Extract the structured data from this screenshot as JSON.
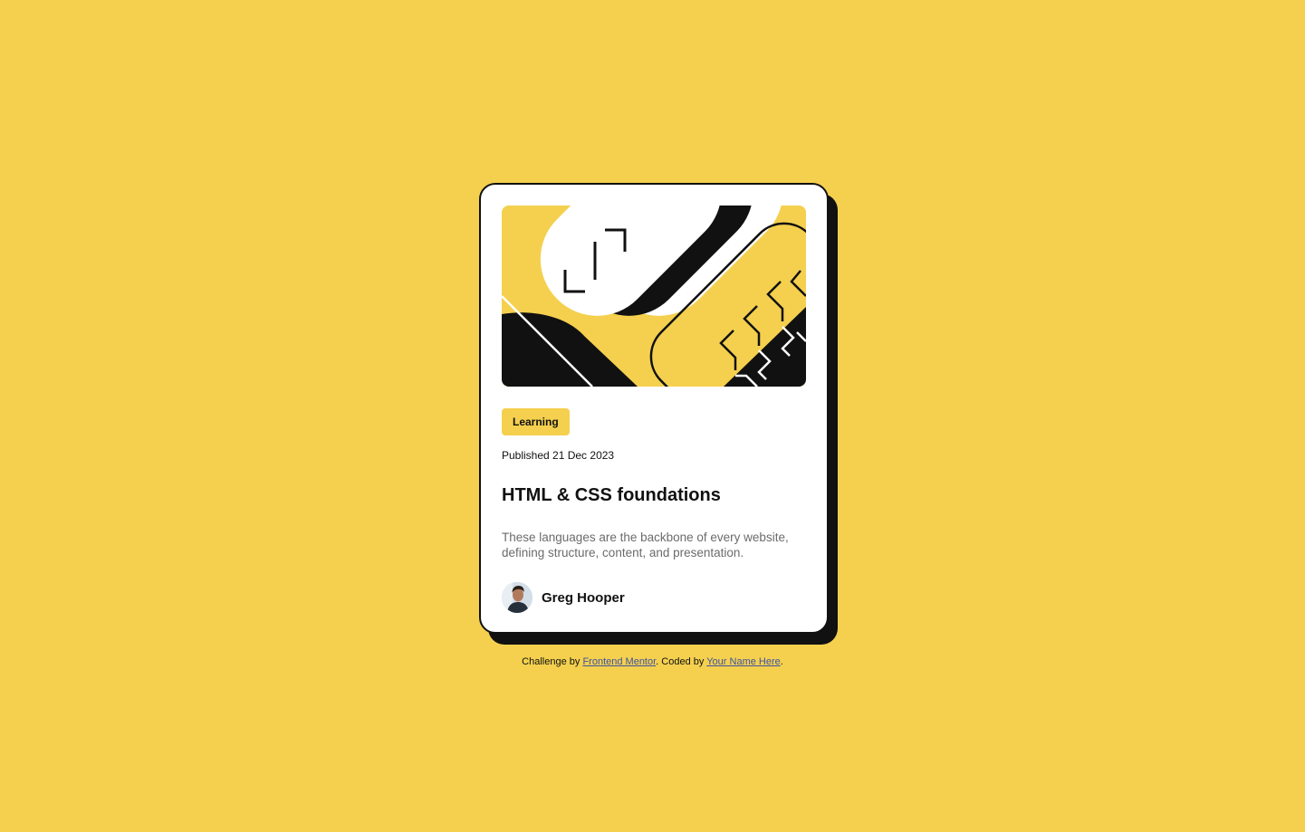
{
  "card": {
    "tag": "Learning",
    "published": "Published 21 Dec 2023",
    "title": "HTML & CSS foundations",
    "description": "These languages are the backbone of every website, defining structure, content, and presentation.",
    "author": "Greg Hooper"
  },
  "attribution": {
    "prefix": "Challenge by ",
    "link1": "Frontend Mentor",
    "middle": ". Coded by ",
    "link2": "Your Name Here",
    "suffix": "."
  },
  "colors": {
    "background": "#F4D04E",
    "card": "#FFFFFF",
    "ink": "#111111",
    "muted": "#6B6B6B",
    "link": "#3E52A3"
  }
}
